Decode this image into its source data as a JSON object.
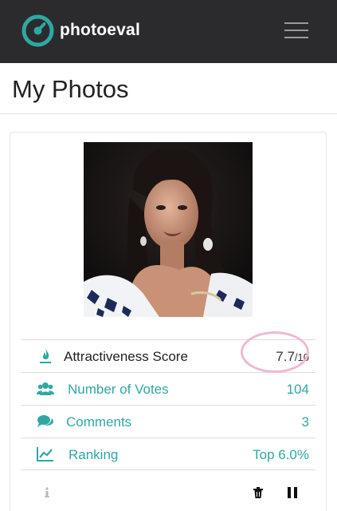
{
  "navbar": {
    "brand": "photoeval",
    "menu_icon": "hamburger-menu-icon"
  },
  "page": {
    "title": "My Photos"
  },
  "photo": {
    "description_icon": "photo"
  },
  "stats": {
    "score": {
      "label": "Attractiveness Score",
      "value": "7.7",
      "denominator": "/10",
      "icon": "flame-icon"
    },
    "votes": {
      "label": "Number of Votes",
      "value": "104",
      "icon": "users-icon"
    },
    "comments": {
      "label": "Comments",
      "value": "3",
      "icon": "comments-icon"
    },
    "ranking": {
      "label": "Ranking",
      "value": "Top 6.0%",
      "icon": "line-chart-icon"
    }
  },
  "actions": {
    "info_icon": "info-icon",
    "delete_icon": "trash-icon",
    "pause_icon": "pause-icon"
  },
  "colors": {
    "navbar_bg": "#2b2b2d",
    "accent_teal": "#2ea8a3",
    "highlight_pink": "#f0b8d4"
  }
}
